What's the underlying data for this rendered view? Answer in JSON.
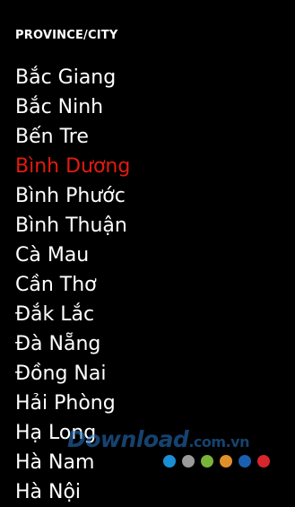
{
  "header": {
    "title": "PROVINCE/CITY"
  },
  "cities": [
    {
      "label": "Bắc Giang",
      "selected": false
    },
    {
      "label": "Bắc Ninh",
      "selected": false
    },
    {
      "label": "Bến Tre",
      "selected": false
    },
    {
      "label": "Bình Dương",
      "selected": true
    },
    {
      "label": "Bình Phước",
      "selected": false
    },
    {
      "label": "Bình Thuận",
      "selected": false
    },
    {
      "label": "Cà Mau",
      "selected": false
    },
    {
      "label": "Cần Thơ",
      "selected": false
    },
    {
      "label": "Đắk Lắc",
      "selected": false
    },
    {
      "label": "Đà Nẵng",
      "selected": false
    },
    {
      "label": "Đồng Nai",
      "selected": false
    },
    {
      "label": "Hải Phòng",
      "selected": false
    },
    {
      "label": "Hạ Long",
      "selected": false
    },
    {
      "label": "Hà Nam",
      "selected": false
    },
    {
      "label": "Hà Nội",
      "selected": false
    }
  ],
  "colors": {
    "background": "#000000",
    "text": "#ffffff",
    "selected": "#e31b0e"
  },
  "watermark": {
    "text": "Download",
    "domain": ".com.vn",
    "dot_colors": [
      "#1a8fd6",
      "#9a9a9a",
      "#79b33a",
      "#e0902a",
      "#1a5fb0",
      "#d7262c"
    ]
  }
}
